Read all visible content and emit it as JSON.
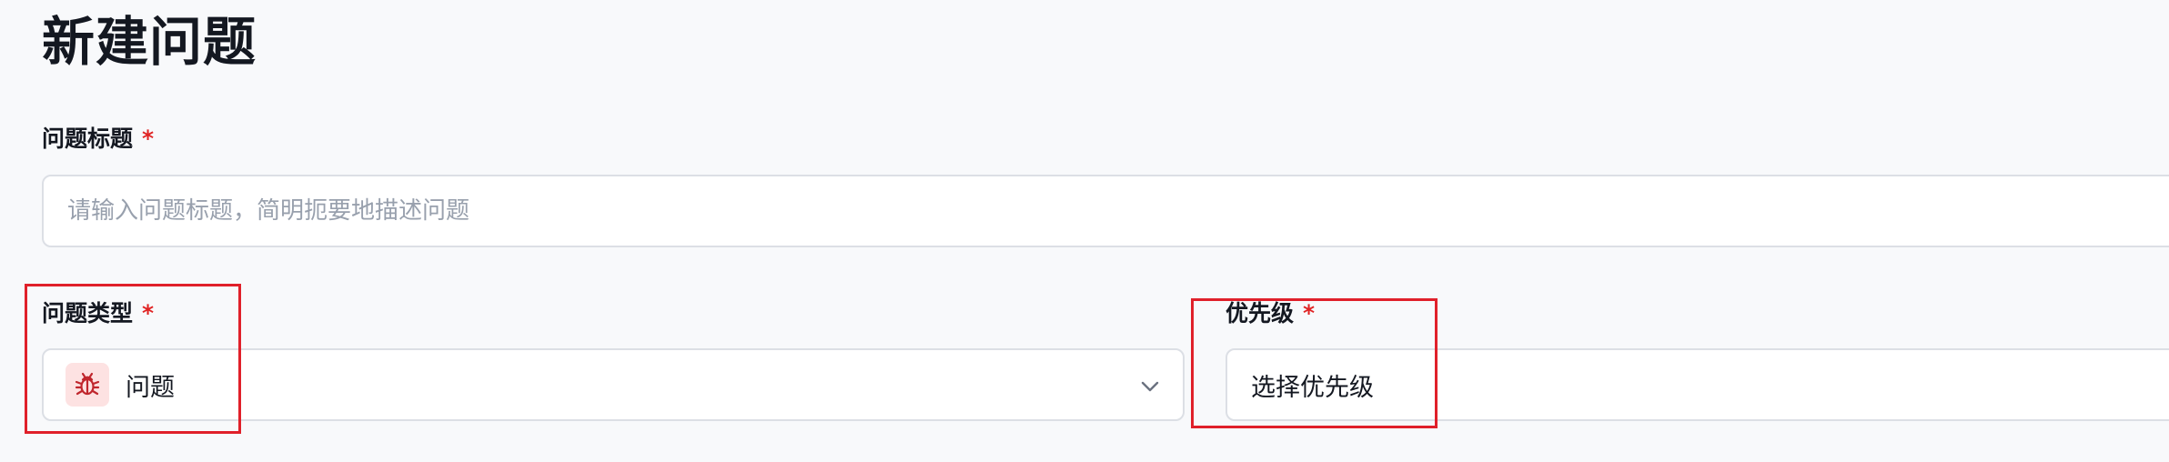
{
  "page": {
    "title": "新建问题"
  },
  "form": {
    "required_mark": "*",
    "issue_title": {
      "label": "问题标题",
      "value": "",
      "placeholder": "请输入问题标题，简明扼要地描述问题"
    },
    "issue_type": {
      "label": "问题类型",
      "selected": "问题",
      "icon": "bug-icon",
      "icon_color": "#c0262d",
      "icon_bg": "#fde2e2"
    },
    "priority": {
      "label": "优先级",
      "placeholder": "选择优先级"
    }
  },
  "highlight_color": "#e0202a"
}
